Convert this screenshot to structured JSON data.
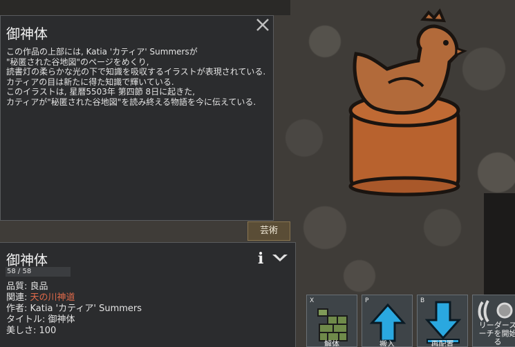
{
  "info_panel": {
    "title": "御神体",
    "body": "この作品の上部には, Katia 'カティア' Summersが\n\"秘匿された谷地図\"のページをめくり,\n読書灯の柔らかな光の下で知識を吸収するイラストが表現されている.カティアの目は新たに得た知識で輝いている.\nこのイラストは, 星暦5503年 第四節 8日に起きた,\nカティアが\"秘匿された谷地図\"を読み終える物語を今に伝えている.",
    "close_icon": "close-icon"
  },
  "tab": {
    "label": "芸術"
  },
  "inspect": {
    "title": "御神体",
    "hp_text": "58 / 58",
    "hp_fraction": 1.0,
    "quality": {
      "label": "品質: ",
      "value": "良品"
    },
    "related": {
      "label": "関連: ",
      "value": "天の川神道"
    },
    "author": {
      "label": "作者: ",
      "value": "Katia 'カティア' Summers"
    },
    "work_title": {
      "label": "タイトル: ",
      "value": "御神体"
    },
    "beauty": {
      "label": "美しさ: ",
      "value": "100"
    }
  },
  "commands": [
    {
      "key": "X",
      "label": "解体",
      "icon": "bricks-icon"
    },
    {
      "key": "P",
      "label": "搬入",
      "icon": "arrow-up-icon"
    },
    {
      "key": "B",
      "label": "再配置",
      "icon": "arrow-down-icon"
    },
    {
      "key": "",
      "label": "リーダースリーチを開始する",
      "label_lines": [
        "リーダース",
        "ーチを開始",
        "る"
      ],
      "icon": "research-icon"
    }
  ],
  "colors": {
    "panel_bg": "#2b2c2e",
    "related_link": "#e06a4a",
    "arrow_blue": "#2aa8e0",
    "brick_green": "#6f8a4a",
    "tab_bg": "#5a4d36"
  }
}
